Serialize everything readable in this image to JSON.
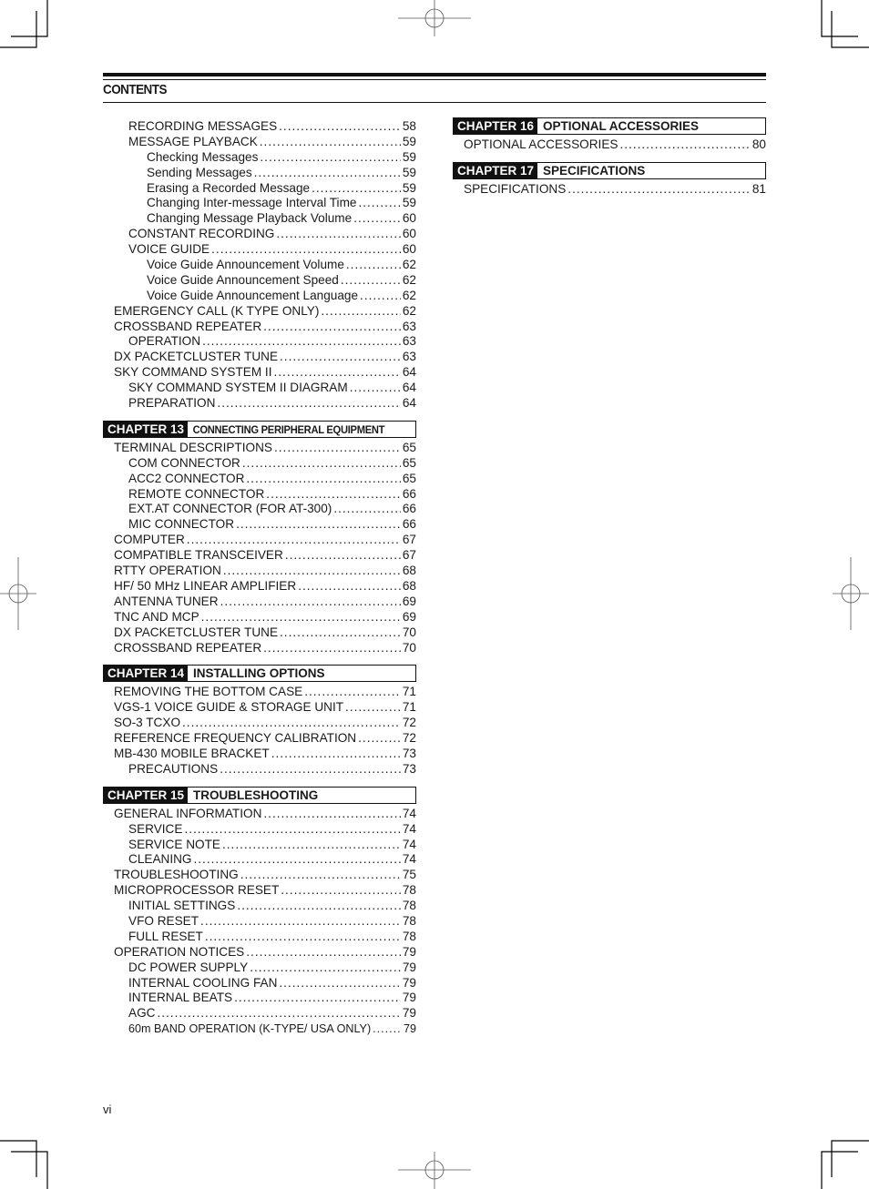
{
  "header": {
    "title": "CONTENTS"
  },
  "left_column": [
    {
      "type": "entry",
      "level": 1,
      "title": "RECORDING MESSAGES",
      "page": "58"
    },
    {
      "type": "entry",
      "level": 1,
      "title": "MESSAGE PLAYBACK",
      "page": "59"
    },
    {
      "type": "entry",
      "level": 2,
      "title": "Checking Messages",
      "page": "59"
    },
    {
      "type": "entry",
      "level": 2,
      "title": "Sending Messages",
      "page": "59"
    },
    {
      "type": "entry",
      "level": 2,
      "title": "Erasing a Recorded Message",
      "page": "59"
    },
    {
      "type": "entry",
      "level": 2,
      "title": "Changing Inter-message Interval Time",
      "page": "59"
    },
    {
      "type": "entry",
      "level": 2,
      "title": "Changing Message Playback Volume",
      "page": "60"
    },
    {
      "type": "entry",
      "level": 1,
      "title": "CONSTANT RECORDING",
      "page": "60"
    },
    {
      "type": "entry",
      "level": 1,
      "title": "VOICE GUIDE",
      "page": "60"
    },
    {
      "type": "entry",
      "level": 2,
      "title": "Voice Guide Announcement Volume",
      "page": "62"
    },
    {
      "type": "entry",
      "level": 2,
      "title": "Voice Guide Announcement Speed",
      "page": "62"
    },
    {
      "type": "entry",
      "level": 2,
      "title": "Voice Guide Announcement Language",
      "page": "62"
    },
    {
      "type": "entry",
      "level": 0,
      "title": "EMERGENCY CALL (K TYPE ONLY)",
      "page": "62"
    },
    {
      "type": "entry",
      "level": 0,
      "title": "CROSSBAND REPEATER",
      "page": "63"
    },
    {
      "type": "entry",
      "level": 1,
      "title": "OPERATION",
      "page": "63"
    },
    {
      "type": "entry",
      "level": 0,
      "title": "DX PACKETCLUSTER TUNE",
      "page": "63"
    },
    {
      "type": "entry",
      "level": 0,
      "title": "SKY COMMAND SYSTEM II",
      "page": "64"
    },
    {
      "type": "entry",
      "level": 1,
      "title": "SKY COMMAND SYSTEM II DIAGRAM",
      "page": "64"
    },
    {
      "type": "entry",
      "level": 1,
      "title": "PREPARATION",
      "page": "64"
    },
    {
      "type": "chapter",
      "number": "CHAPTER 13",
      "name": "CONNECTING PERIPHERAL EQUIPMENT",
      "condensed": true
    },
    {
      "type": "entry",
      "level": 0,
      "title": "TERMINAL DESCRIPTIONS",
      "page": "65"
    },
    {
      "type": "entry",
      "level": 1,
      "title": "COM CONNECTOR",
      "page": "65"
    },
    {
      "type": "entry",
      "level": 1,
      "title": "ACC2 CONNECTOR",
      "page": "65"
    },
    {
      "type": "entry",
      "level": 1,
      "title": "REMOTE CONNECTOR",
      "page": "66"
    },
    {
      "type": "entry",
      "level": 1,
      "title": "EXT.AT CONNECTOR (FOR AT-300)",
      "page": "66"
    },
    {
      "type": "entry",
      "level": 1,
      "title": "MIC CONNECTOR",
      "page": "66"
    },
    {
      "type": "entry",
      "level": 0,
      "title": "COMPUTER",
      "page": "67"
    },
    {
      "type": "entry",
      "level": 0,
      "title": "COMPATIBLE TRANSCEIVER",
      "page": "67"
    },
    {
      "type": "entry",
      "level": 0,
      "title": "RTTY OPERATION",
      "page": "68"
    },
    {
      "type": "entry",
      "level": 0,
      "title": "HF/ 50 MHz LINEAR AMPLIFIER",
      "page": "68"
    },
    {
      "type": "entry",
      "level": 0,
      "title": "ANTENNA TUNER",
      "page": "69"
    },
    {
      "type": "entry",
      "level": 0,
      "title": "TNC AND MCP",
      "page": "69"
    },
    {
      "type": "entry",
      "level": 0,
      "title": "DX PACKETCLUSTER TUNE",
      "page": "70"
    },
    {
      "type": "entry",
      "level": 0,
      "title": "CROSSBAND REPEATER",
      "page": "70"
    },
    {
      "type": "chapter",
      "number": "CHAPTER 14",
      "name": "INSTALLING OPTIONS"
    },
    {
      "type": "entry",
      "level": 0,
      "title": "REMOVING THE BOTTOM CASE",
      "page": "71"
    },
    {
      "type": "entry",
      "level": 0,
      "title": "VGS-1 VOICE GUIDE & STORAGE UNIT",
      "page": "71"
    },
    {
      "type": "entry",
      "level": 0,
      "title": "SO-3 TCXO",
      "page": "72"
    },
    {
      "type": "entry",
      "level": 0,
      "title": "REFERENCE FREQUENCY CALIBRATION",
      "page": "72"
    },
    {
      "type": "entry",
      "level": 0,
      "title": "MB-430 MOBILE BRACKET",
      "page": "73"
    },
    {
      "type": "entry",
      "level": 1,
      "title": "PRECAUTIONS",
      "page": "73"
    },
    {
      "type": "chapter",
      "number": "CHAPTER 15",
      "name": "TROUBLESHOOTING"
    },
    {
      "type": "entry",
      "level": 0,
      "title": "GENERAL INFORMATION",
      "page": "74"
    },
    {
      "type": "entry",
      "level": 1,
      "title": "SERVICE",
      "page": "74"
    },
    {
      "type": "entry",
      "level": 1,
      "title": "SERVICE NOTE",
      "page": "74"
    },
    {
      "type": "entry",
      "level": 1,
      "title": "CLEANING",
      "page": "74"
    },
    {
      "type": "entry",
      "level": 0,
      "title": "TROUBLESHOOTING",
      "page": "75"
    },
    {
      "type": "entry",
      "level": 0,
      "title": "MICROPROCESSOR RESET",
      "page": "78"
    },
    {
      "type": "entry",
      "level": 1,
      "title": "INITIAL SETTINGS",
      "page": "78"
    },
    {
      "type": "entry",
      "level": 1,
      "title": "VFO RESET",
      "page": "78"
    },
    {
      "type": "entry",
      "level": 1,
      "title": "FULL RESET",
      "page": "78"
    },
    {
      "type": "entry",
      "level": 0,
      "title": "OPERATION NOTICES",
      "page": "79"
    },
    {
      "type": "entry",
      "level": 1,
      "title": "DC POWER SUPPLY",
      "page": "79"
    },
    {
      "type": "entry",
      "level": 1,
      "title": "INTERNAL COOLING FAN",
      "page": "79"
    },
    {
      "type": "entry",
      "level": 1,
      "title": "INTERNAL BEATS",
      "page": "79"
    },
    {
      "type": "entry",
      "level": 1,
      "title": "AGC",
      "page": "79"
    },
    {
      "type": "entry",
      "level": 1,
      "title": "60m BAND OPERATION (K-TYPE/ USA ONLY)",
      "page": "79",
      "small": true
    }
  ],
  "right_column": [
    {
      "type": "chapter",
      "number": "CHAPTER 16",
      "name": "OPTIONAL ACCESSORIES"
    },
    {
      "type": "entry",
      "level": 0,
      "title": "OPTIONAL ACCESSORIES",
      "page": "80"
    },
    {
      "type": "gap"
    },
    {
      "type": "chapter",
      "number": "CHAPTER 17",
      "name": "SPECIFICATIONS"
    },
    {
      "type": "entry",
      "level": 0,
      "title": "SPECIFICATIONS",
      "page": "81"
    }
  ],
  "footer": {
    "page_number": "vi"
  }
}
